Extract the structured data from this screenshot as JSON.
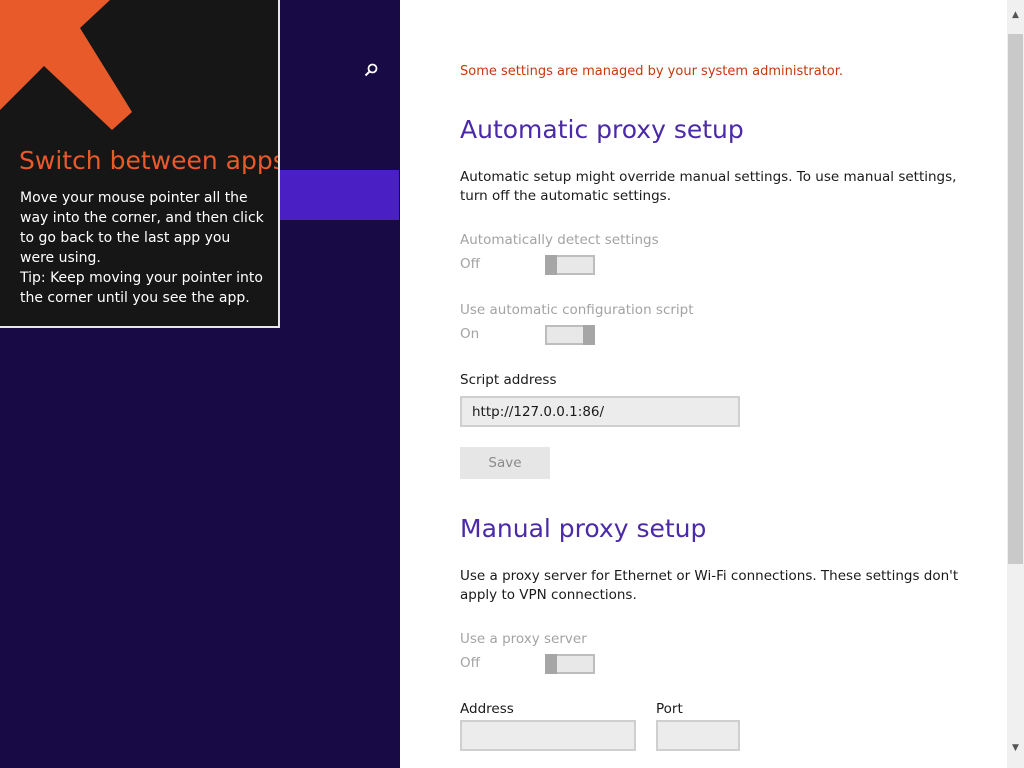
{
  "tip": {
    "title": "Switch between apps",
    "body_line1": "Move your mouse pointer all the way into the corner, and then click to go back to the last app you were using.",
    "body_line2": "Tip: Keep moving your pointer into the corner until you see the app."
  },
  "nav": {
    "search_icon": "magnifier-icon"
  },
  "settings": {
    "admin_note": "Some settings are managed by your system administrator.",
    "auto": {
      "title": "Automatic proxy setup",
      "description": "Automatic setup might override manual settings. To use manual settings, turn off the automatic settings.",
      "detect_label": "Automatically detect settings",
      "detect_state": "Off",
      "script_label": "Use automatic configuration script",
      "script_state": "On",
      "address_label": "Script address",
      "address_value": "http://127.0.0.1:86/",
      "save_label": "Save"
    },
    "manual": {
      "title": "Manual proxy setup",
      "description": "Use a proxy server for Ethernet or Wi-Fi connections. These settings don't apply to VPN connections.",
      "proxy_label": "Use a proxy server",
      "proxy_state": "Off",
      "address_label": "Address",
      "address_value": "",
      "port_label": "Port",
      "port_value": ""
    }
  },
  "scrollbar": {
    "up_glyph": "▲",
    "down_glyph": "▼"
  },
  "colors": {
    "nav_background": "#180a45",
    "nav_selected": "#4a20c4",
    "accent_orange": "#e95a2a",
    "admin_note": "#c6390a",
    "section_title": "#4a2aa8"
  }
}
